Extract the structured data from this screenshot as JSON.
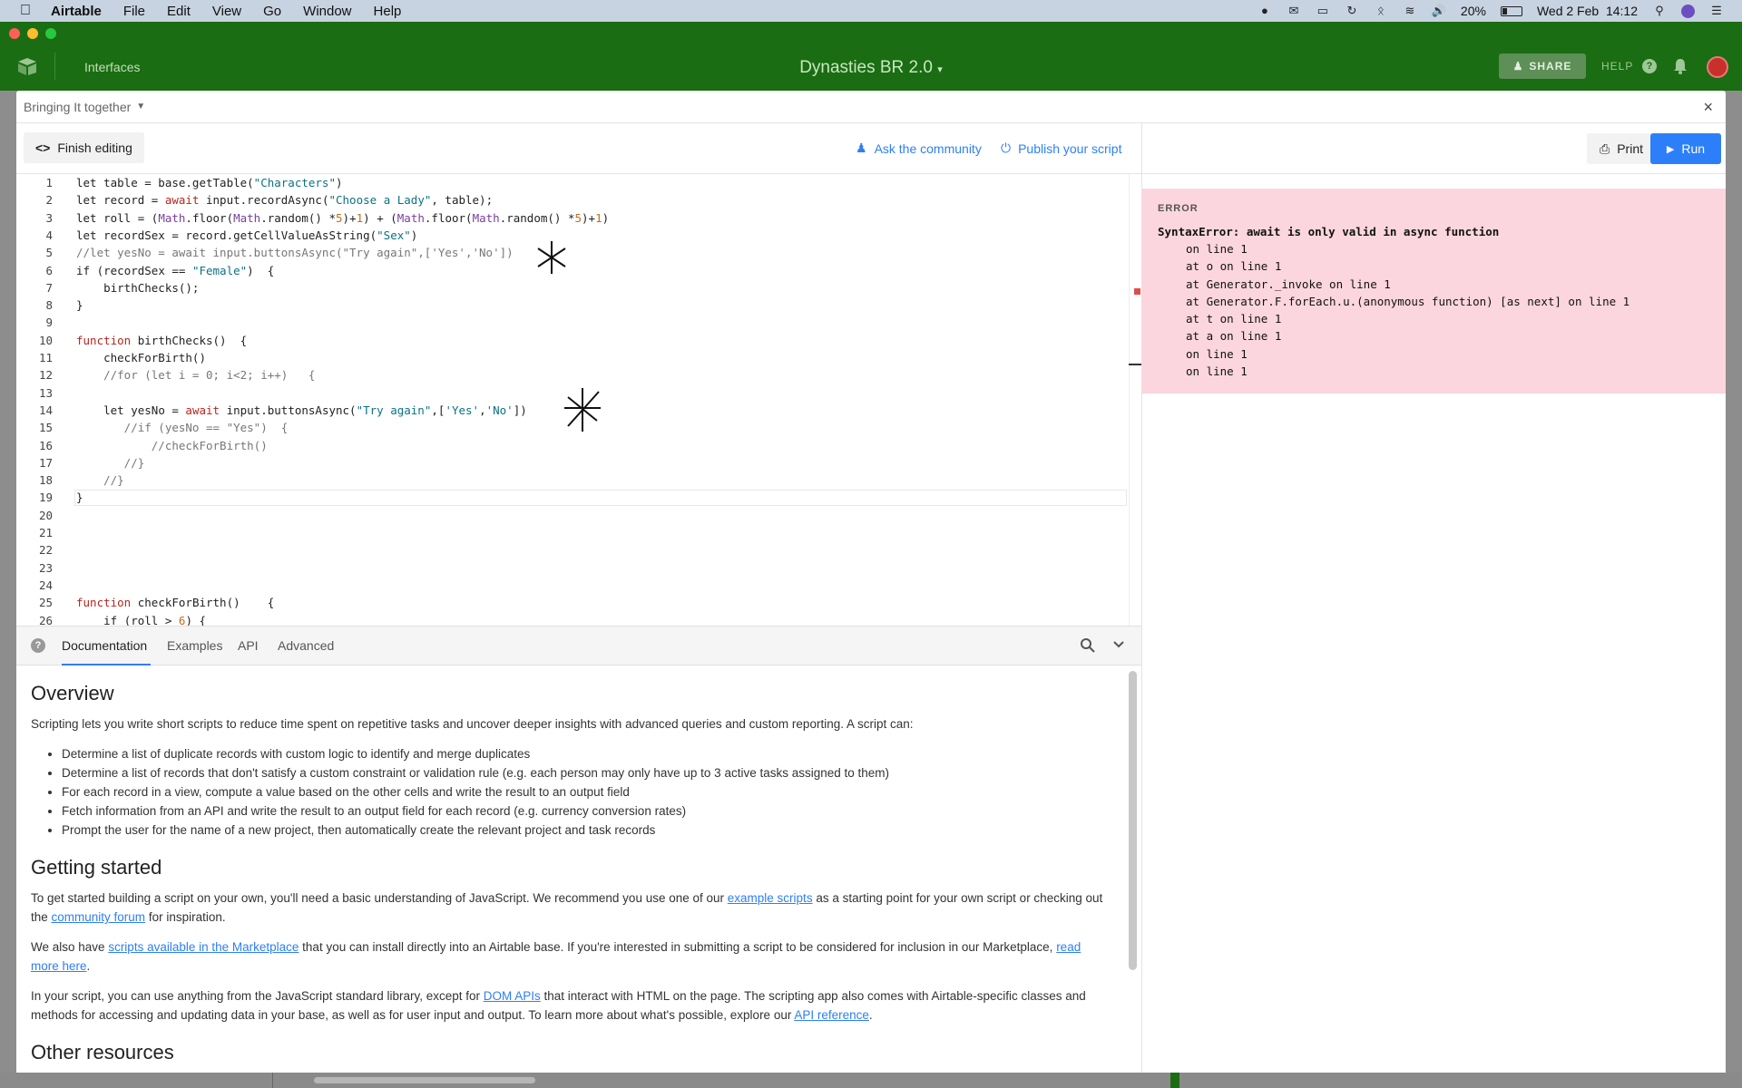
{
  "menubar": {
    "app": "Airtable",
    "items": [
      "File",
      "Edit",
      "View",
      "Go",
      "Window",
      "Help"
    ],
    "battery": "20%",
    "clock": "Wed 2 Feb  14:12"
  },
  "header": {
    "interfaces": "Interfaces",
    "base_name": "Dynasties BR 2.0",
    "share": "SHARE",
    "help": "HELP",
    "help_q": "?"
  },
  "modal": {
    "title": "Bringing It together",
    "close": "×",
    "finish_editing": "Finish editing",
    "ask_community": "Ask the community",
    "publish": "Publish your script",
    "print": "Print",
    "run": "Run"
  },
  "code_lines": [
    "let table = base.getTable(\"Characters\")",
    "let record = await input.recordAsync(\"Choose a Lady\", table);",
    "let roll = (Math.floor(Math.random() *5)+1) + (Math.floor(Math.random() *5)+1)",
    "let recordSex = record.getCellValueAsString(\"Sex\")",
    "//let yesNo = await input.buttonsAsync(\"Try again\",['Yes','No'])",
    "if (recordSex == \"Female\")  {",
    "    birthChecks();",
    "}",
    "",
    "function birthChecks()  {",
    "    checkForBirth()",
    "    //for (let i = 0; i<2; i++)   {",
    "",
    "    let yesNo = await input.buttonsAsync(\"Try again\",['Yes','No'])",
    "       //if (yesNo == \"Yes\")  {",
    "           //checkForBirth()",
    "       //}",
    "    //}",
    "}",
    "",
    "",
    "",
    "",
    "",
    "function checkForBirth()    {",
    "    if (roll > 6) {"
  ],
  "error": {
    "label": "ERROR",
    "message": "SyntaxError: await is only valid in async function",
    "trace": [
      "on line 1",
      "at o on line 1",
      "at Generator._invoke on line 1",
      "at Generator.F.forEach.u.(anonymous function) [as next] on line 1",
      "at t on line 1",
      "at a on line 1",
      "on line 1",
      "on line 1"
    ]
  },
  "docs": {
    "help_q": "?",
    "tabs": [
      "Documentation",
      "Examples",
      "API",
      "Advanced"
    ],
    "overview_title": "Overview",
    "overview_text": "Scripting lets you write short scripts to reduce time spent on repetitive tasks and uncover deeper insights with advanced queries and custom reporting. A script can:",
    "bullets": [
      "Determine a list of duplicate records with custom logic to identify and merge duplicates",
      "Determine a list of records that don't satisfy a custom constraint or validation rule (e.g. each person may only have up to 3 active tasks assigned to them)",
      "For each record in a view, compute a value based on the other cells and write the result to an output field",
      "Fetch information from an API and write the result to an output field for each record (e.g. currency conversion rates)",
      "Prompt the user for the name of a new project, then automatically create the relevant project and task records"
    ],
    "getting_started_title": "Getting started",
    "gs_p1_a": "To get started building a script on your own, you'll need a basic understanding of JavaScript. We recommend you use one of our ",
    "gs_p1_link1": "example scripts",
    "gs_p1_b": " as a starting point for your own script or checking out the ",
    "gs_p1_link2": "community forum",
    "gs_p1_c": " for inspiration.",
    "gs_p2_a": "We also have ",
    "gs_p2_link1": "scripts available in the Marketplace",
    "gs_p2_b": " that you can install directly into an Airtable base. If you're interested in submitting a script to be considered for inclusion in our Marketplace, ",
    "gs_p2_link2": "read more here",
    "gs_p2_c": ".",
    "gs_p3_a": "In your script, you can use anything from the JavaScript standard library, except for ",
    "gs_p3_link1": "DOM APIs",
    "gs_p3_b": " that interact with HTML on the page. The scripting app also comes with Airtable-specific classes and methods for accessing and updating data in your base, as well as for user input and output. To learn more about what's possible, explore our ",
    "gs_p3_link2": "API reference",
    "gs_p3_c": ".",
    "other_title": "Other resources"
  }
}
